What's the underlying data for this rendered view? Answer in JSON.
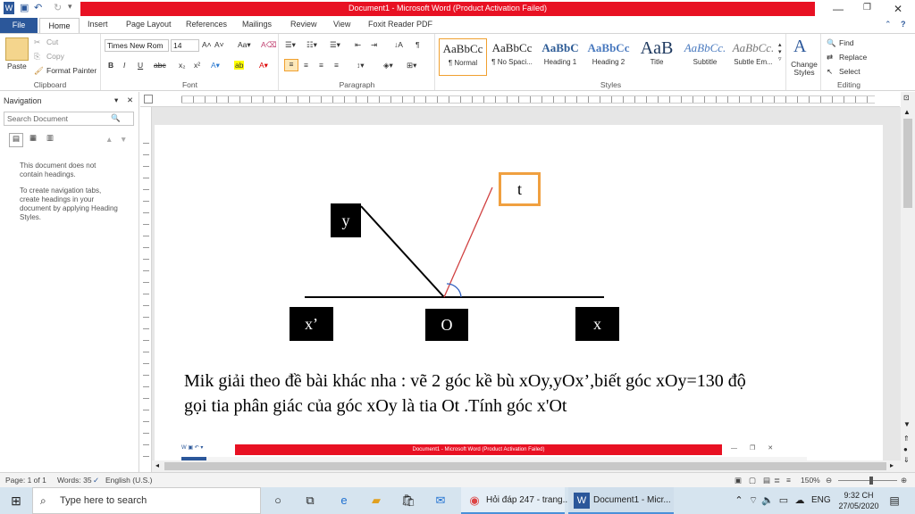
{
  "window": {
    "title": "Document1 - Microsoft Word (Product Activation Failed)"
  },
  "tabs": [
    "File",
    "Home",
    "Insert",
    "Page Layout",
    "References",
    "Mailings",
    "Review",
    "View",
    "Foxit Reader PDF"
  ],
  "clipboard": {
    "paste": "Paste",
    "cut": "Cut",
    "copy": "Copy",
    "format_painter": "Format Painter",
    "label": "Clipboard"
  },
  "font": {
    "name": "Times New Rom",
    "size": "14",
    "label": "Font"
  },
  "paragraph": {
    "label": "Paragraph"
  },
  "styles": {
    "label": "Styles",
    "items": [
      {
        "preview": "AaBbCc",
        "name": "¶ Normal"
      },
      {
        "preview": "AaBbCc",
        "name": "¶ No Spaci..."
      },
      {
        "preview": "AaBbC",
        "name": "Heading 1"
      },
      {
        "preview": "AaBbCc",
        "name": "Heading 2"
      },
      {
        "preview": "AaB",
        "name": "Title"
      },
      {
        "preview": "AaBbCc.",
        "name": "Subtitle"
      },
      {
        "preview": "AaBbCc.",
        "name": "Subtle Em..."
      }
    ],
    "change": "Change Styles"
  },
  "editing": {
    "find": "Find",
    "replace": "Replace",
    "select": "Select",
    "label": "Editing"
  },
  "navigation": {
    "title": "Navigation",
    "search_placeholder": "Search Document",
    "msg1": "This document does not contain headings.",
    "msg2": "To create navigation tabs, create headings in your document by applying Heading Styles."
  },
  "figure": {
    "y": "y",
    "t": "t",
    "x_prime": "x’",
    "o": "O",
    "x": "x"
  },
  "body_text": {
    "line1": "Mik giải theo đề bài khác nha : vẽ 2 góc kề bù xOy,yOx’,biết góc xOy=130 độ",
    "line2": "gọi tia phân giác của góc xOy là tia Ot .Tính góc x'Ot"
  },
  "embedded": {
    "title": "Document1 - Microsoft Word (Product Activation Failed)"
  },
  "status": {
    "page": "Page: 1 of 1",
    "words": "Words: 35",
    "language": "English (U.S.)",
    "zoom": "150%"
  },
  "taskbar": {
    "search": "Type here to search",
    "app1": "Hỏi đáp 247 - trang...",
    "app2": "Document1 - Micr...",
    "lang": "ENG",
    "time": "9:32 CH",
    "date": "27/05/2020"
  },
  "colors": {
    "accent": "#2b579a",
    "titlebar_red": "#e81123",
    "label_orange": "#f0a040",
    "ray_red": "#d04040"
  }
}
